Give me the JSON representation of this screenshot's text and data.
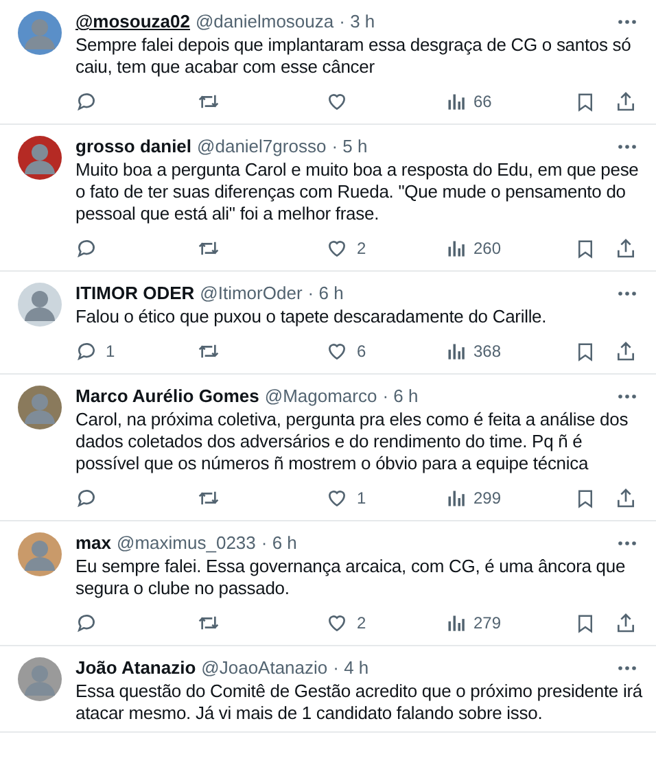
{
  "tweets": [
    {
      "name": "@mosouza02",
      "handle": "@danielmosouza",
      "time": "· 3 h",
      "hovered": true,
      "color": "#5a8fc8",
      "text": "Sempre falei depois que implantaram essa desgraça de CG o santos só caiu, tem que acabar com esse câncer",
      "stats": {
        "views": "66"
      }
    },
    {
      "name": "grosso daniel",
      "handle": "@daniel7grosso",
      "time": "· 5 h",
      "hovered": false,
      "color": "#b52a24",
      "text": "Muito boa a pergunta Carol e muito boa a resposta do Edu, em que pese o fato de ter suas diferenças com Rueda. \"Que mude o pensamento do pessoal que está ali\" foi a melhor frase.",
      "stats": {
        "likes": "2",
        "views": "260"
      }
    },
    {
      "name": "ITIMOR ODER",
      "handle": "@ItimorOder",
      "time": "· 6 h",
      "hovered": false,
      "color": "#ccd6dd",
      "text": "Falou o ético que puxou o tapete descaradamente do Carille.",
      "stats": {
        "replies": "1",
        "likes": "6",
        "views": "368"
      }
    },
    {
      "name": "Marco Aurélio Gomes",
      "handle": "@Magomarco",
      "time": "· 6 h",
      "hovered": false,
      "color": "#8a7a5c",
      "text": "Carol, na próxima coletiva, pergunta pra eles como é feita a análise dos dados coletados dos adversários e do rendimento do time. Pq ñ é possível que os números ñ mostrem o óbvio para a equipe técnica",
      "stats": {
        "likes": "1",
        "views": "299"
      }
    },
    {
      "name": "max",
      "handle": "@maximus_0233",
      "time": "· 6 h",
      "hovered": false,
      "color": "#c99a6a",
      "text": "Eu sempre falei. Essa governança arcaica, com CG, é uma âncora que segura o clube no passado.",
      "stats": {
        "likes": "2",
        "views": "279"
      }
    },
    {
      "name": "João Atanazio",
      "handle": "@JoaoAtanazio",
      "time": "· 4 h",
      "hovered": false,
      "color": "#9a9a9a",
      "text": "Essa questão do Comitê de Gestão acredito que o próximo presidente irá atacar mesmo. Já vi mais de 1 candidato falando sobre isso."
    }
  ]
}
